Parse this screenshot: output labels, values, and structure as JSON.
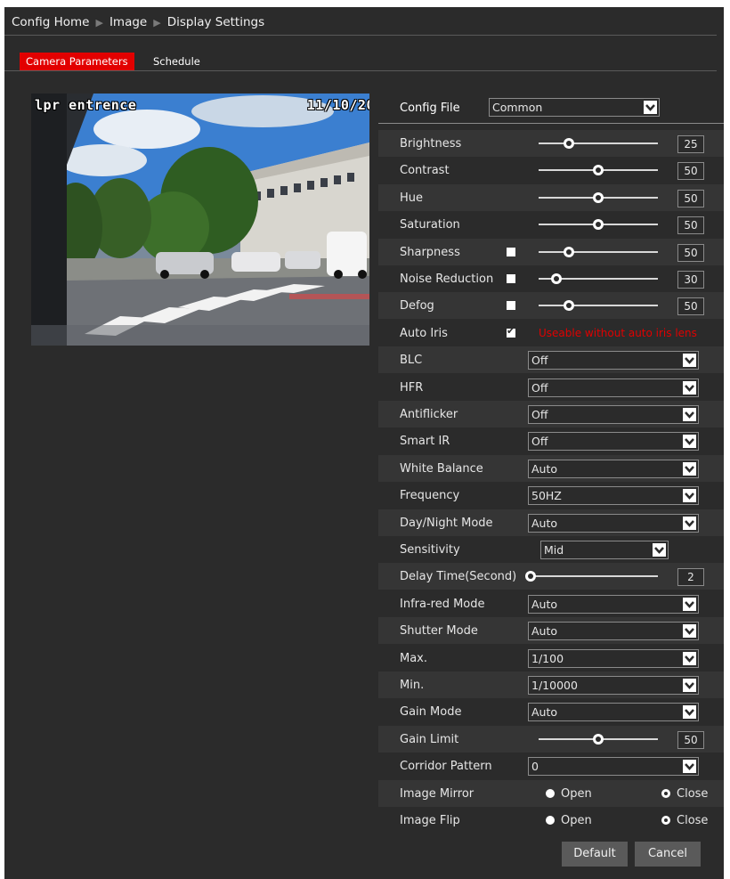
{
  "breadcrumb": [
    "Config Home",
    "Image",
    "Display Settings"
  ],
  "tabs": {
    "camera_parameters": "Camera Parameters",
    "schedule": "Schedule"
  },
  "preview": {
    "osd_name": "lpr entrence",
    "osd_date": "11/10/20"
  },
  "config_file": {
    "label": "Config File",
    "value": "Common"
  },
  "sliders": {
    "brightness": {
      "label": "Brightness",
      "value": "25",
      "fraction": 0.25
    },
    "contrast": {
      "label": "Contrast",
      "value": "50",
      "fraction": 0.5
    },
    "hue": {
      "label": "Hue",
      "value": "50",
      "fraction": 0.5
    },
    "saturation": {
      "label": "Saturation",
      "value": "50",
      "fraction": 0.5
    },
    "sharpness": {
      "label": "Sharpness",
      "value": "50",
      "fraction": 0.25
    },
    "noise_reduction": {
      "label": "Noise Reduction",
      "value": "30",
      "fraction": 0.15
    },
    "defog": {
      "label": "Defog",
      "value": "50",
      "fraction": 0.25
    },
    "delay_time": {
      "label": "Delay Time(Second)",
      "value": "2",
      "fraction": 0.02
    },
    "gain_limit": {
      "label": "Gain Limit",
      "value": "50",
      "fraction": 0.5
    }
  },
  "auto_iris": {
    "label": "Auto Iris",
    "checked": true,
    "warning": "Useable without auto iris lens"
  },
  "selects": {
    "blc": {
      "label": "BLC",
      "value": "Off"
    },
    "hfr": {
      "label": "HFR",
      "value": "Off"
    },
    "antiflicker": {
      "label": "Antiflicker",
      "value": "Off"
    },
    "smart_ir": {
      "label": "Smart IR",
      "value": "Off"
    },
    "white_balance": {
      "label": "White Balance",
      "value": "Auto"
    },
    "frequency": {
      "label": "Frequency",
      "value": "50HZ"
    },
    "day_night_mode": {
      "label": "Day/Night Mode",
      "value": "Auto"
    },
    "sensitivity": {
      "label": "Sensitivity",
      "value": "Mid"
    },
    "infrared_mode": {
      "label": "Infra-red Mode",
      "value": "Auto"
    },
    "shutter_mode": {
      "label": "Shutter Mode",
      "value": "Auto"
    },
    "max": {
      "label": "Max.",
      "value": "1/100"
    },
    "min": {
      "label": "Min.",
      "value": "1/10000"
    },
    "gain_mode": {
      "label": "Gain Mode",
      "value": "Auto"
    },
    "corridor_pattern": {
      "label": "Corridor Pattern",
      "value": "0"
    }
  },
  "image_mirror": {
    "label": "Image Mirror",
    "open": "Open",
    "close": "Close",
    "selected": "Close"
  },
  "image_flip": {
    "label": "Image Flip",
    "open": "Open",
    "close": "Close",
    "selected": "Close"
  },
  "buttons": {
    "default": "Default",
    "cancel": "Cancel"
  },
  "colors": {
    "accent": "#e20000",
    "background": "#2b2b2b",
    "warning": "#e00000"
  }
}
